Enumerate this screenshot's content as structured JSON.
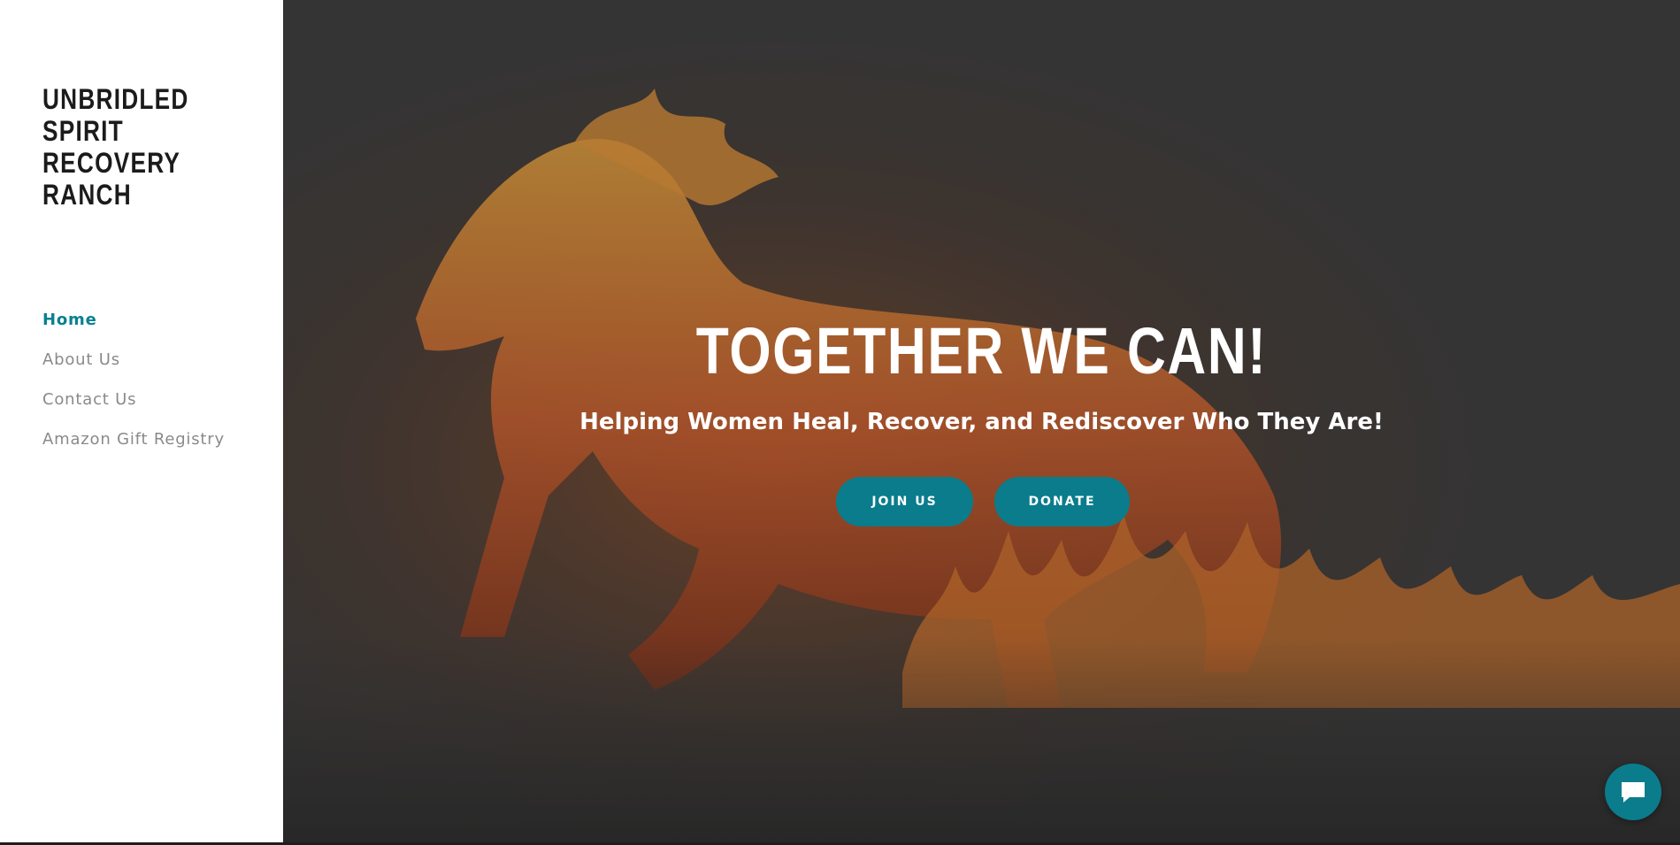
{
  "site": {
    "title_lines": [
      "UNBRIDLED",
      "SPIRIT",
      "RECOVERY",
      "RANCH"
    ]
  },
  "nav": {
    "items": [
      {
        "label": "Home",
        "active": true
      },
      {
        "label": "About Us",
        "active": false
      },
      {
        "label": "Contact Us",
        "active": false
      },
      {
        "label": "Amazon Gift Registry",
        "active": false
      }
    ]
  },
  "hero": {
    "title": "TOGETHER WE CAN!",
    "subtitle": "Helping Women Heal, Recover, and Rediscover Who They Are!",
    "join_label": "JOIN US",
    "donate_label": "DONATE",
    "background_icon": "fire-horse-image"
  },
  "chat": {
    "icon": "chat-bubble-icon"
  },
  "colors": {
    "accent": "#0a7c8c",
    "nav_active": "#0a8091",
    "nav_inactive": "#8a8a8a",
    "title_text": "#1b1b1b",
    "hero_bg": "#3a3a3a"
  }
}
